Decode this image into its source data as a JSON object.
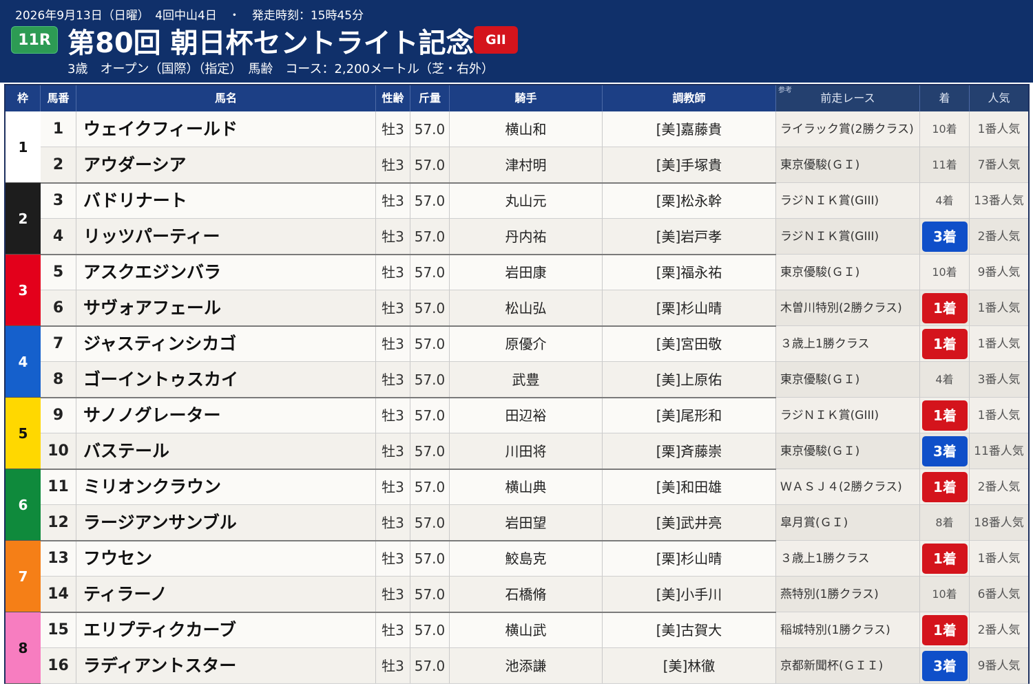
{
  "header": {
    "meta": "2026年9月13日（日曜）　4回中山4日　・　発走時刻：15時45分",
    "race_no": "11R",
    "title": "第80回 朝日杯セントライト記念",
    "grade": "GII",
    "sub": "3歳　オープン（国際）（指定）　馬齢　コース：2,200メートル（芝・右外）"
  },
  "columns": {
    "waku": "枠",
    "umaban": "馬番",
    "name": "馬名",
    "sexage": "性齢",
    "kinryo": "斤量",
    "jockey": "騎手",
    "trainer": "調教師",
    "ref_note": "参考",
    "prevrace": "前走レース",
    "chaku": "着",
    "ninki": "人気"
  },
  "colors": {
    "header_bg": "#10306a",
    "win_badge": "#d4141c",
    "third_badge": "#0f4fc9",
    "waku": [
      {
        "bg": "#ffffff",
        "fg": "#111111"
      },
      {
        "bg": "#1d1d1d",
        "fg": "#ffffff"
      },
      {
        "bg": "#e3001b",
        "fg": "#ffffff"
      },
      {
        "bg": "#1560cc",
        "fg": "#ffffff"
      },
      {
        "bg": "#ffd800",
        "fg": "#111111"
      },
      {
        "bg": "#0f8a3c",
        "fg": "#ffffff"
      },
      {
        "bg": "#f57f17",
        "fg": "#ffffff"
      },
      {
        "bg": "#f77dc0",
        "fg": "#111111"
      }
    ]
  },
  "waku_labels": [
    "1",
    "2",
    "3",
    "4",
    "5",
    "6",
    "7",
    "8"
  ],
  "horses": [
    {
      "umaban": "1",
      "name": "ウェイクフィールド",
      "sexage": "牡3",
      "kinryo": "57.0",
      "jockey": "横山和",
      "trainer": "[美]嘉藤貴",
      "prevrace": "ライラック賞(2勝クラス)",
      "chaku": "10着",
      "ninki": "1番人気",
      "badge": ""
    },
    {
      "umaban": "2",
      "name": "アウダーシア",
      "sexage": "牡3",
      "kinryo": "57.0",
      "jockey": "津村明",
      "trainer": "[美]手塚貴",
      "prevrace": "東京優駿(ＧＩ)",
      "chaku": "11着",
      "ninki": "7番人気",
      "badge": ""
    },
    {
      "umaban": "3",
      "name": "バドリナート",
      "sexage": "牡3",
      "kinryo": "57.0",
      "jockey": "丸山元",
      "trainer": "[栗]松永幹",
      "prevrace": "ラジＮＩＫ賞(GIII)",
      "chaku": "4着",
      "ninki": "13番人気",
      "badge": ""
    },
    {
      "umaban": "4",
      "name": "リッツパーティー",
      "sexage": "牡3",
      "kinryo": "57.0",
      "jockey": "丹内祐",
      "trainer": "[美]岩戸孝",
      "prevrace": "ラジＮＩＫ賞(GIII)",
      "chaku": "3着",
      "ninki": "2番人気",
      "badge": "third"
    },
    {
      "umaban": "5",
      "name": "アスクエジンバラ",
      "sexage": "牡3",
      "kinryo": "57.0",
      "jockey": "岩田康",
      "trainer": "[栗]福永祐",
      "prevrace": "東京優駿(ＧＩ)",
      "chaku": "10着",
      "ninki": "9番人気",
      "badge": ""
    },
    {
      "umaban": "6",
      "name": "サヴォアフェール",
      "sexage": "牡3",
      "kinryo": "57.0",
      "jockey": "松山弘",
      "trainer": "[栗]杉山晴",
      "prevrace": "木曽川特別(2勝クラス)",
      "chaku": "1着",
      "ninki": "1番人気",
      "badge": "win"
    },
    {
      "umaban": "7",
      "name": "ジャスティンシカゴ",
      "sexage": "牡3",
      "kinryo": "57.0",
      "jockey": "原優介",
      "trainer": "[美]宮田敬",
      "prevrace": "３歳上1勝クラス",
      "chaku": "1着",
      "ninki": "1番人気",
      "badge": "win"
    },
    {
      "umaban": "8",
      "name": "ゴーイントゥスカイ",
      "sexage": "牡3",
      "kinryo": "57.0",
      "jockey": "武豊",
      "trainer": "[美]上原佑",
      "prevrace": "東京優駿(ＧＩ)",
      "chaku": "4着",
      "ninki": "3番人気",
      "badge": ""
    },
    {
      "umaban": "9",
      "name": "サノノグレーター",
      "sexage": "牡3",
      "kinryo": "57.0",
      "jockey": "田辺裕",
      "trainer": "[美]尾形和",
      "prevrace": "ラジＮＩＫ賞(GIII)",
      "chaku": "1着",
      "ninki": "1番人気",
      "badge": "win"
    },
    {
      "umaban": "10",
      "name": "バステール",
      "sexage": "牡3",
      "kinryo": "57.0",
      "jockey": "川田将",
      "trainer": "[栗]斉藤崇",
      "prevrace": "東京優駿(ＧＩ)",
      "chaku": "3着",
      "ninki": "11番人気",
      "badge": "third"
    },
    {
      "umaban": "11",
      "name": "ミリオンクラウン",
      "sexage": "牡3",
      "kinryo": "57.0",
      "jockey": "横山典",
      "trainer": "[美]和田雄",
      "prevrace": "ＷＡＳＪ４(2勝クラス)",
      "chaku": "1着",
      "ninki": "2番人気",
      "badge": "win"
    },
    {
      "umaban": "12",
      "name": "ラージアンサンブル",
      "sexage": "牡3",
      "kinryo": "57.0",
      "jockey": "岩田望",
      "trainer": "[美]武井亮",
      "prevrace": "皐月賞(ＧＩ)",
      "chaku": "8着",
      "ninki": "18番人気",
      "badge": ""
    },
    {
      "umaban": "13",
      "name": "フウセン",
      "sexage": "牡3",
      "kinryo": "57.0",
      "jockey": "鮫島克",
      "trainer": "[栗]杉山晴",
      "prevrace": "３歳上1勝クラス",
      "chaku": "1着",
      "ninki": "1番人気",
      "badge": "win"
    },
    {
      "umaban": "14",
      "name": "ティラーノ",
      "sexage": "牡3",
      "kinryo": "57.0",
      "jockey": "石橋脩",
      "trainer": "[美]小手川",
      "prevrace": "燕特別(1勝クラス)",
      "chaku": "10着",
      "ninki": "6番人気",
      "badge": ""
    },
    {
      "umaban": "15",
      "name": "エリプティクカーブ",
      "sexage": "牡3",
      "kinryo": "57.0",
      "jockey": "横山武",
      "trainer": "[美]古賀大",
      "prevrace": "稲城特別(1勝クラス)",
      "chaku": "1着",
      "ninki": "2番人気",
      "badge": "win"
    },
    {
      "umaban": "16",
      "name": "ラディアントスター",
      "sexage": "牡3",
      "kinryo": "57.0",
      "jockey": "池添謙",
      "trainer": "[美]林徹",
      "prevrace": "京都新聞杯(ＧＩＩ)",
      "chaku": "3着",
      "ninki": "9番人気",
      "badge": "third"
    }
  ]
}
